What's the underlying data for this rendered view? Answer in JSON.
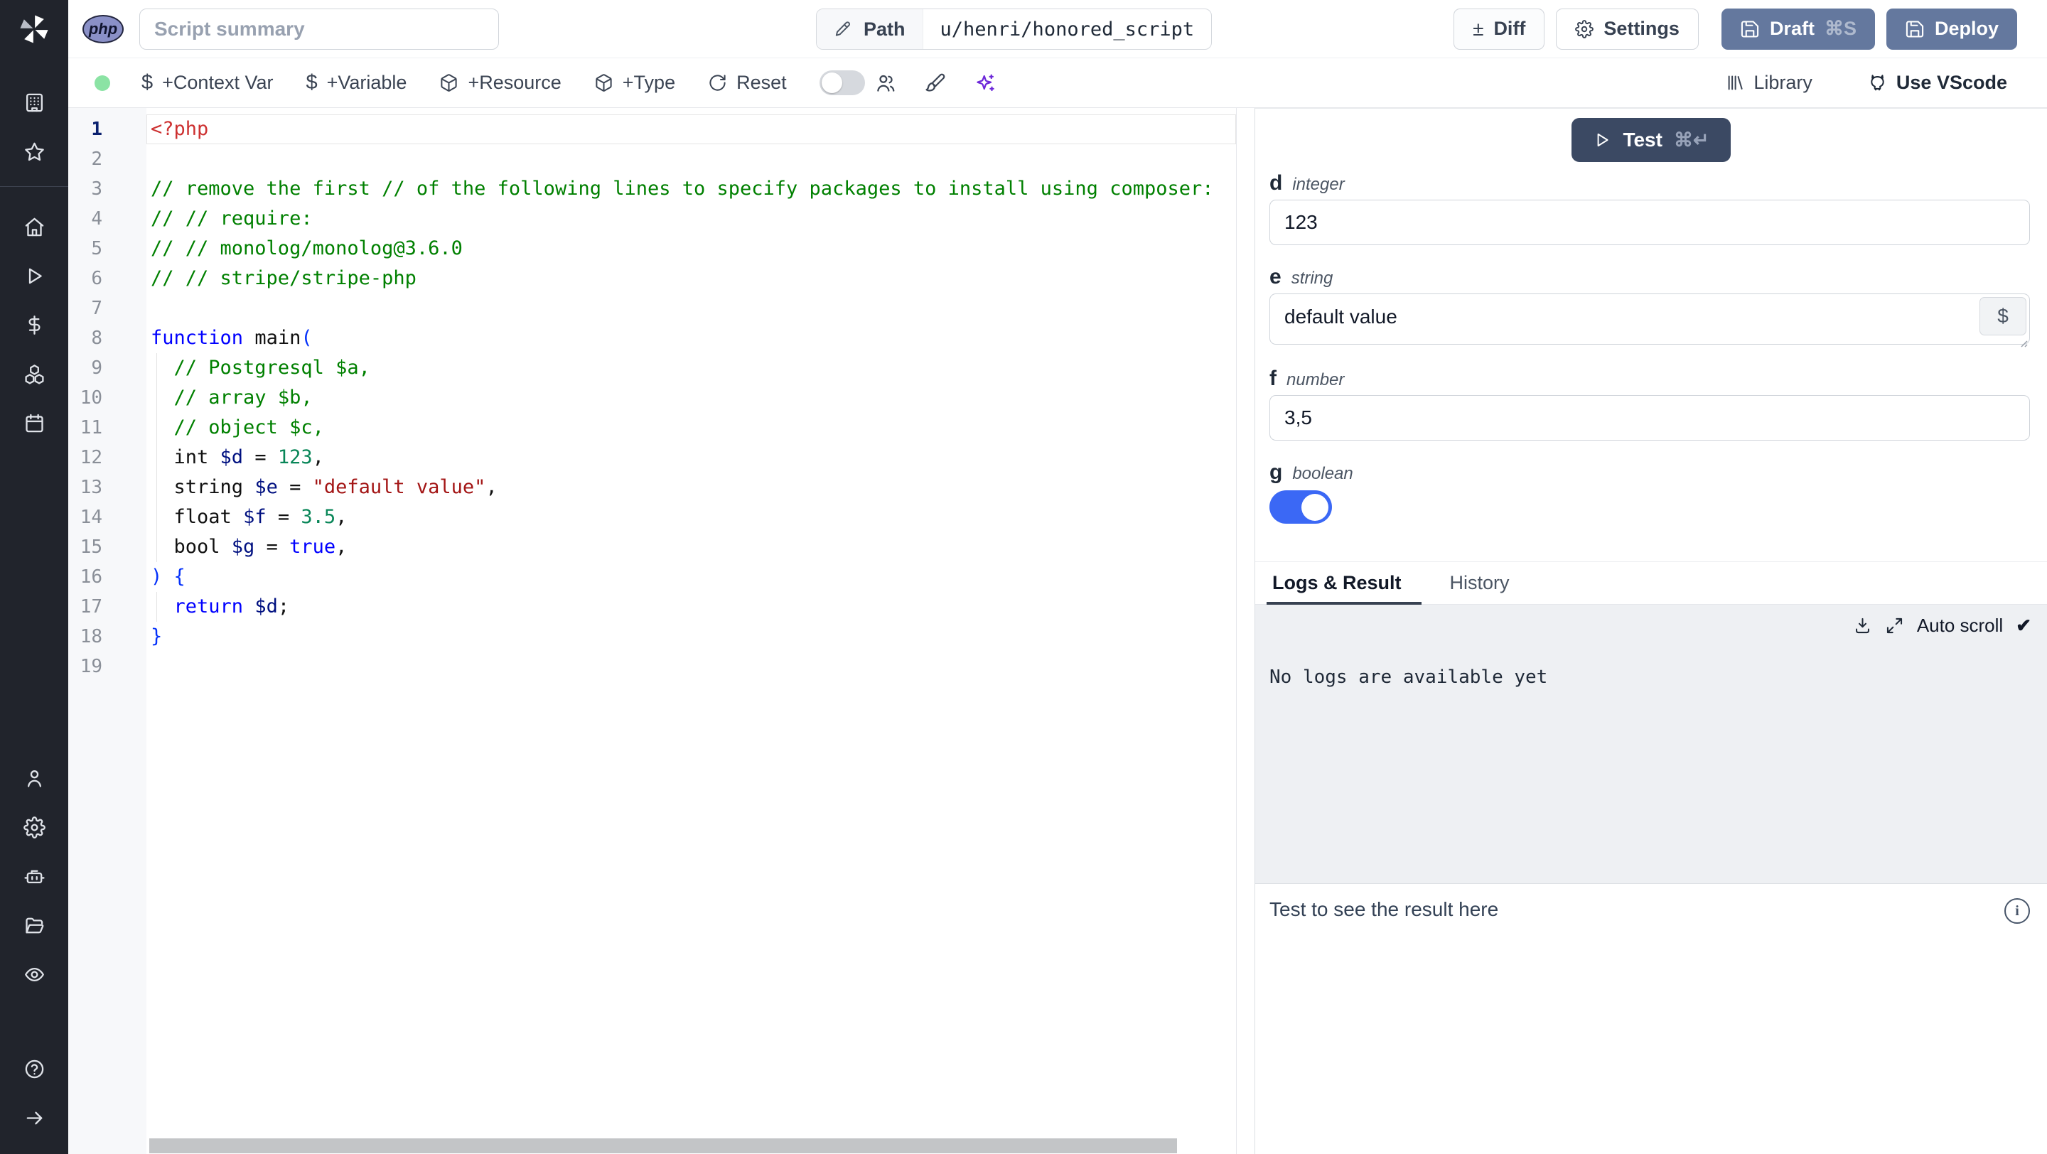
{
  "header": {
    "language_badge": "php",
    "summary_placeholder": "Script summary",
    "path_label": "Path",
    "path_value": "u/henri/honored_script",
    "diff_label": "Diff",
    "settings_label": "Settings",
    "draft_label": "Draft",
    "draft_shortcut": "⌘S",
    "deploy_label": "Deploy"
  },
  "toolbar": {
    "status_color": "#8be3a4",
    "context_var_label": "+Context Var",
    "variable_label": "+Variable",
    "resource_label": "+Resource",
    "type_label": "+Type",
    "reset_label": "Reset",
    "library_label": "Library",
    "vscode_label": "Use VScode"
  },
  "glyphs": {
    "diff": "±",
    "dollar": "$",
    "check": "✔",
    "info": "i"
  },
  "sidebar": {
    "top": [
      "workspace-icon",
      "favorites-icon"
    ],
    "main": [
      "home-icon",
      "runs-icon",
      "variables-icon",
      "resources-icon",
      "schedules-icon"
    ],
    "secondary": [
      "account-icon",
      "settings-icon",
      "workers-icon",
      "folders-icon",
      "audit-logs-icon"
    ],
    "footer": [
      "help-icon",
      "expand-sidebar-icon"
    ]
  },
  "editor": {
    "language": "php",
    "lines": [
      {
        "t": [
          [
            "<?php",
            "tag"
          ]
        ]
      },
      {
        "t": []
      },
      {
        "t": [
          [
            "// remove the first // of the following lines to specify packages to install using composer:",
            "c"
          ]
        ]
      },
      {
        "t": [
          [
            "// // require:",
            "c"
          ]
        ]
      },
      {
        "t": [
          [
            "// // monolog/monolog@3.6.0",
            "c"
          ]
        ]
      },
      {
        "t": [
          [
            "// // stripe/stripe-php",
            "c"
          ]
        ]
      },
      {
        "t": []
      },
      {
        "t": [
          [
            "function",
            "k"
          ],
          [
            " ",
            "p"
          ],
          [
            "main",
            "f"
          ],
          [
            "(",
            "b"
          ]
        ]
      },
      {
        "g": 1,
        "t": [
          [
            "  ",
            "p"
          ],
          [
            "// Postgresql $a,",
            "c"
          ]
        ]
      },
      {
        "g": 1,
        "t": [
          [
            "  ",
            "p"
          ],
          [
            "// array $b,",
            "c"
          ]
        ]
      },
      {
        "g": 1,
        "t": [
          [
            "  ",
            "p"
          ],
          [
            "// object $c,",
            "c"
          ]
        ]
      },
      {
        "g": 1,
        "t": [
          [
            "  ",
            "p"
          ],
          [
            "int ",
            "p"
          ],
          [
            "$d",
            "v"
          ],
          [
            " = ",
            "p"
          ],
          [
            "123",
            "n"
          ],
          [
            ",",
            "p"
          ]
        ]
      },
      {
        "g": 1,
        "t": [
          [
            "  ",
            "p"
          ],
          [
            "string ",
            "p"
          ],
          [
            "$e",
            "v"
          ],
          [
            " = ",
            "p"
          ],
          [
            "\"default value\"",
            "s"
          ],
          [
            ",",
            "p"
          ]
        ]
      },
      {
        "g": 1,
        "t": [
          [
            "  ",
            "p"
          ],
          [
            "float ",
            "p"
          ],
          [
            "$f",
            "v"
          ],
          [
            " = ",
            "p"
          ],
          [
            "3.5",
            "n"
          ],
          [
            ",",
            "p"
          ]
        ]
      },
      {
        "g": 1,
        "t": [
          [
            "  ",
            "p"
          ],
          [
            "bool ",
            "p"
          ],
          [
            "$g",
            "v"
          ],
          [
            " = ",
            "p"
          ],
          [
            "true",
            "k"
          ],
          [
            ",",
            "p"
          ]
        ]
      },
      {
        "t": [
          [
            ") {",
            "b"
          ]
        ]
      },
      {
        "g": 1,
        "t": [
          [
            "  ",
            "p"
          ],
          [
            "return",
            "k"
          ],
          [
            " ",
            "p"
          ],
          [
            "$d",
            "v"
          ],
          [
            ";",
            "p"
          ]
        ]
      },
      {
        "t": [
          [
            "}",
            "b"
          ]
        ]
      },
      {
        "t": []
      }
    ]
  },
  "run_panel": {
    "test_label": "Test",
    "test_shortcut": "⌘↵",
    "fields": [
      {
        "name": "d",
        "type": "integer",
        "value": "123",
        "kind": "input"
      },
      {
        "name": "e",
        "type": "string",
        "value": "default value",
        "kind": "textarea"
      },
      {
        "name": "f",
        "type": "number",
        "value": "3,5",
        "kind": "input"
      },
      {
        "name": "g",
        "type": "boolean",
        "value": true,
        "kind": "toggle"
      }
    ],
    "tabs": [
      "Logs & Result",
      "History"
    ],
    "active_tab": "Logs & Result",
    "auto_scroll_label": "Auto scroll",
    "no_logs_text": "No logs are available yet",
    "result_placeholder": "Test to see the result here"
  },
  "colors": {
    "sidebar_bg": "#21242c",
    "slate_button": "#64789e",
    "test_button": "#3b4963",
    "toggle_on": "#3b68f5"
  }
}
